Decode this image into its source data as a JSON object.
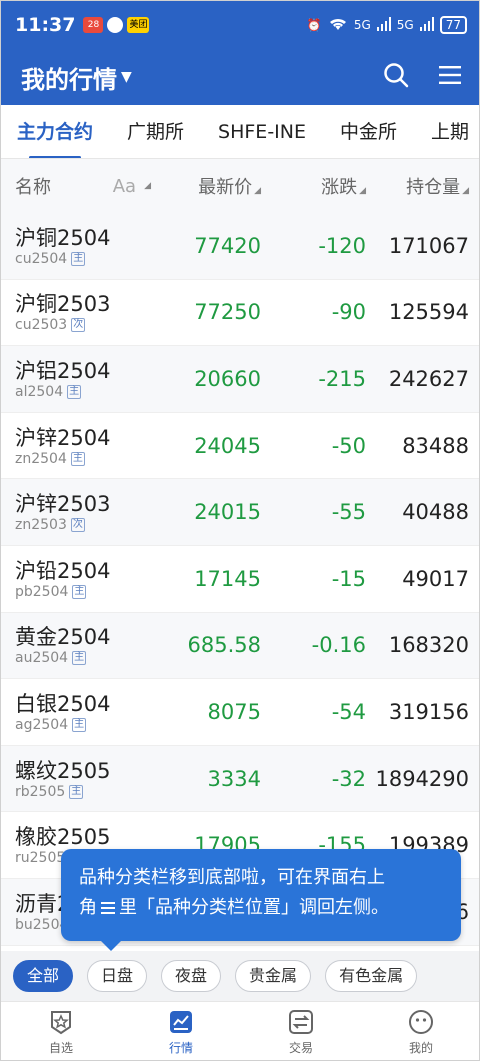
{
  "status_bar": {
    "time": "11:37",
    "battery": "77",
    "signal_label_1": "5G",
    "signal_label_2": "5G",
    "badge_1": "28",
    "badge_3": "美团"
  },
  "app_bar": {
    "title": "我的行情"
  },
  "tabs": [
    {
      "label": "主力合约",
      "active": true
    },
    {
      "label": "广期所"
    },
    {
      "label": "SHFE-INE"
    },
    {
      "label": "中金所"
    },
    {
      "label": "上期"
    }
  ],
  "header": {
    "name": "名称",
    "aa": "Aa",
    "price": "最新价",
    "change": "涨跌",
    "oi": "持仓量"
  },
  "rows": [
    {
      "name": "沪铜2504",
      "code": "cu2504",
      "tag": "主",
      "price": "77420",
      "change": "-120",
      "oi": "171067"
    },
    {
      "name": "沪铜2503",
      "code": "cu2503",
      "tag": "次",
      "price": "77250",
      "change": "-90",
      "oi": "125594"
    },
    {
      "name": "沪铝2504",
      "code": "al2504",
      "tag": "主",
      "price": "20660",
      "change": "-215",
      "oi": "242627"
    },
    {
      "name": "沪锌2504",
      "code": "zn2504",
      "tag": "主",
      "price": "24045",
      "change": "-50",
      "oi": "83488"
    },
    {
      "name": "沪锌2503",
      "code": "zn2503",
      "tag": "次",
      "price": "24015",
      "change": "-55",
      "oi": "40488"
    },
    {
      "name": "沪铅2504",
      "code": "pb2504",
      "tag": "主",
      "price": "17145",
      "change": "-15",
      "oi": "49017"
    },
    {
      "name": "黄金2504",
      "code": "au2504",
      "tag": "主",
      "price": "685.58",
      "change": "-0.16",
      "oi": "168320"
    },
    {
      "name": "白银2504",
      "code": "ag2504",
      "tag": "主",
      "price": "8075",
      "change": "-54",
      "oi": "319156"
    },
    {
      "name": "螺纹2505",
      "code": "rb2505",
      "tag": "主",
      "price": "3334",
      "change": "-32",
      "oi": "1894290"
    },
    {
      "name": "橡胶2505",
      "code": "ru2505",
      "tag": "主",
      "price": "17905",
      "change": "-155",
      "oi": "199389"
    },
    {
      "name": "沥青2504",
      "code": "bu2504",
      "tag": "主",
      "price": "",
      "change": "",
      "oi": "6"
    }
  ],
  "tooltip": {
    "line1": "品种分类栏移到底部啦，可在界面右上",
    "line2_a": "角",
    "line2_b": "里「品种分类栏位置」调回左侧。"
  },
  "filters": [
    {
      "label": "全部",
      "active": true
    },
    {
      "label": "日盘"
    },
    {
      "label": "夜盘"
    },
    {
      "label": "贵金属"
    },
    {
      "label": "有色金属"
    }
  ],
  "bottom_nav": [
    {
      "label": "自选",
      "icon": "star-shield-icon"
    },
    {
      "label": "行情",
      "icon": "chart-icon",
      "active": true
    },
    {
      "label": "交易",
      "icon": "transfer-icon"
    },
    {
      "label": "我的",
      "icon": "face-icon"
    }
  ],
  "colors": {
    "primary": "#2a62c4",
    "down": "#1f9a41",
    "tooltip": "#2a74d8"
  }
}
